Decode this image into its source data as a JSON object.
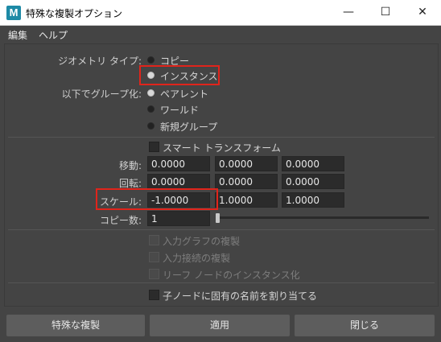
{
  "window": {
    "title": "特殊な複製オプション",
    "icon_letter": "M",
    "minimize": "—",
    "maximize": "☐",
    "close": "✕"
  },
  "menu": {
    "edit": "編集",
    "help": "ヘルプ"
  },
  "geometry_type": {
    "label": "ジオメトリ タイプ:",
    "options": [
      "コピー",
      "インスタンス"
    ],
    "selected": "インスタンス"
  },
  "group_under": {
    "label": "以下でグループ化:",
    "options": [
      "ペアレント",
      "ワールド",
      "新規グループ"
    ],
    "selected": "ペアレント"
  },
  "smart_transform": {
    "label": "スマート トランスフォーム",
    "checked": false
  },
  "translate": {
    "label": "移動:",
    "values": [
      "0.0000",
      "0.0000",
      "0.0000"
    ]
  },
  "rotate": {
    "label": "回転:",
    "values": [
      "0.0000",
      "0.0000",
      "0.0000"
    ]
  },
  "scale": {
    "label": "スケール:",
    "values": [
      "-1.0000",
      "1.0000",
      "1.0000"
    ]
  },
  "copies": {
    "label": "コピー数:",
    "value": "1"
  },
  "disabled_options": [
    "入力グラフの複製",
    "入力接続の複製",
    "リーフ ノードのインスタンス化"
  ],
  "unique_names": {
    "label": "子ノードに固有の名前を割り当てる",
    "checked": false
  },
  "buttons": {
    "duplicate": "特殊な複製",
    "apply": "適用",
    "close": "閉じる"
  },
  "colors": {
    "highlight": "#e0241b",
    "background": "#444444",
    "field": "#2b2b2b",
    "button": "#5d5d5d"
  }
}
